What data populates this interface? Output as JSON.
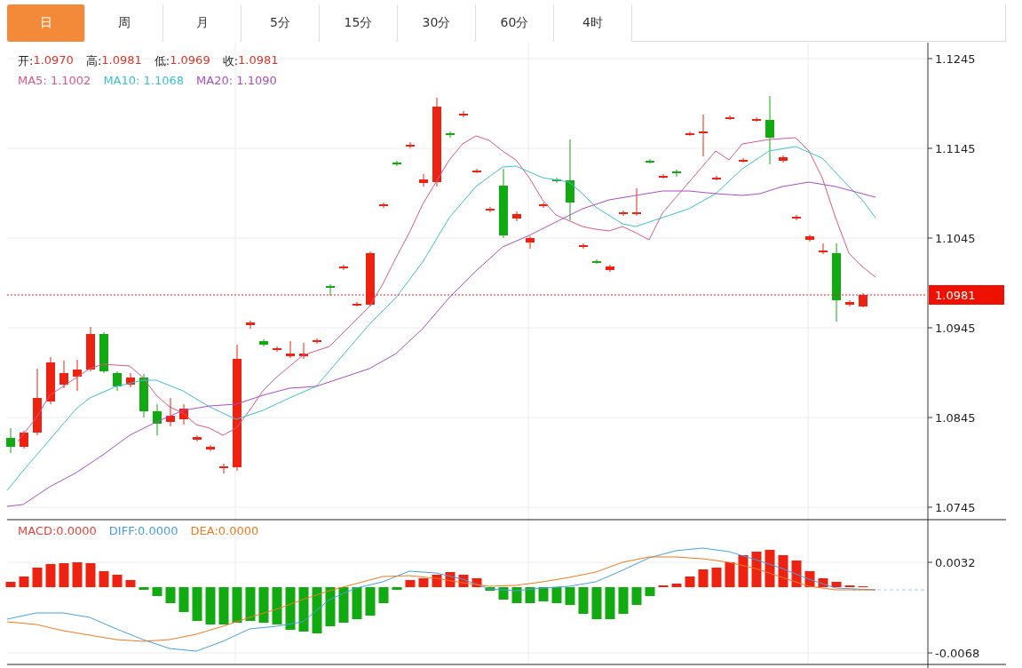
{
  "tabs": [
    {
      "label": "日",
      "selected": true
    },
    {
      "label": "周",
      "selected": false
    },
    {
      "label": "月",
      "selected": false
    },
    {
      "label": "5分",
      "selected": false
    },
    {
      "label": "15分",
      "selected": false
    },
    {
      "label": "30分",
      "selected": false
    },
    {
      "label": "60分",
      "selected": false
    },
    {
      "label": "4时",
      "selected": false
    }
  ],
  "price_legend": [
    {
      "label": "开:",
      "value": "1.0970"
    },
    {
      "label": "高:",
      "value": "1.0981"
    },
    {
      "label": "低:",
      "value": "1.0969"
    },
    {
      "label": "收:",
      "value": "1.0981"
    }
  ],
  "ma_legend": [
    {
      "label": "MA5:",
      "value": "1.1002",
      "color": "#d9578a"
    },
    {
      "label": "MA10:",
      "value": "1.1068",
      "color": "#3ebfd0"
    },
    {
      "label": "MA20:",
      "value": "1.1090",
      "color": "#a84fbf"
    }
  ],
  "price_axis_ticks": [
    "1.1245",
    "1.1145",
    "1.1045",
    "1.0945",
    "1.0845",
    "1.0745"
  ],
  "current_price": "1.0981",
  "macd_legend": [
    {
      "label": "MACD:",
      "value": "0.0000",
      "color": "#e0453a"
    },
    {
      "label": "DIFF:",
      "value": "0.0000",
      "color": "#4a9ee0"
    },
    {
      "label": "DEA:",
      "value": "0.0000",
      "color": "#ee7a22"
    }
  ],
  "macd_axis_ticks": [
    "0.0032",
    "-0.0068"
  ]
}
